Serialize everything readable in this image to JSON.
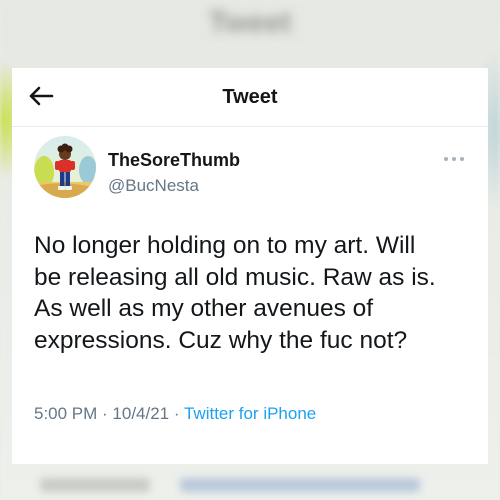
{
  "background": {
    "blurred_title": "Tweet"
  },
  "header": {
    "title": "Tweet",
    "back_icon": "arrow-left-icon"
  },
  "author": {
    "display_name": "TheSoreThumb",
    "handle": "@BucNesta",
    "avatar": "avatar-illustration"
  },
  "more_icon": "more-horizontal-icon",
  "tweet": {
    "text": "No longer holding on to my art. Will\nbe releasing all old music. Raw as is.\nAs well as my other avenues of\nexpressions. Cuz why the fuc not?",
    "time": "5:00 PM",
    "separator": " · ",
    "date": "10/4/21",
    "source": "Twitter for iPhone"
  },
  "colors": {
    "text_primary": "#14171a",
    "text_secondary": "#657786",
    "link": "#1da1f2"
  }
}
